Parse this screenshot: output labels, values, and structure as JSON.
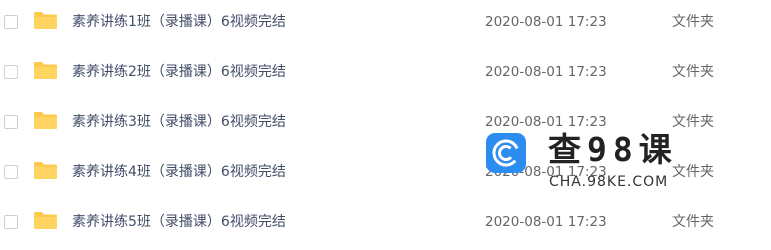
{
  "files": [
    {
      "name": "素养讲练1班（录播课）6视频完结",
      "modified": "2020-08-01 17:23",
      "type": "文件夹"
    },
    {
      "name": "素养讲练2班（录播课）6视频完结",
      "modified": "2020-08-01 17:23",
      "type": "文件夹"
    },
    {
      "name": "素养讲练3班（录播课）6视频完结",
      "modified": "2020-08-01 17:23",
      "type": "文件夹"
    },
    {
      "name": "素养讲练4班（录播课）6视频完结",
      "modified": "2020-08-01 17:23",
      "type": "文件夹"
    },
    {
      "name": "素养讲练5班（录播课）6视频完结",
      "modified": "2020-08-01 17:23",
      "type": "文件夹"
    }
  ],
  "watermark": {
    "title": "查98课",
    "url": "CHA.98KE.COM"
  },
  "colors": {
    "folder": "#ffc94d",
    "watermark_logo": "#2d8cf0"
  },
  "icons": {
    "file_row": "folder-icon",
    "watermark": "logo-icon"
  }
}
